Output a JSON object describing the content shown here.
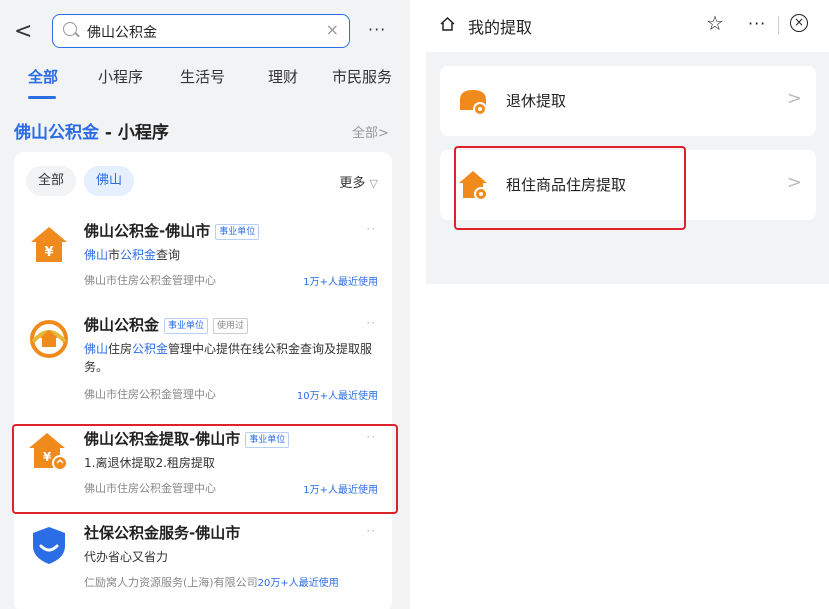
{
  "left": {
    "search": {
      "back": "<",
      "query": "佛山公积金",
      "clear": "×",
      "more": "···"
    },
    "tabs": [
      "全部",
      "小程序",
      "生活号",
      "理财",
      "市民服务"
    ],
    "section": {
      "title_hl": "佛山公积金",
      "title_rest": " - 小程序",
      "all": "全部>"
    },
    "filters": {
      "all": "全部",
      "foshan": "佛山",
      "more": "更多",
      "more_icon": "▽"
    },
    "items": [
      {
        "title": "佛山公积金-佛山市",
        "badge": "事业单位",
        "desc_a": "佛山",
        "desc_b": "市",
        "desc_c": "公积金",
        "desc_d": "查询",
        "org": "佛山市住房公积金管理中心",
        "users": "1万+人最近使用",
        "more": "··"
      },
      {
        "title": "佛山公积金",
        "badge": "事业单位",
        "badge2": "使用过",
        "desc_a": "佛山",
        "desc_b": "住房",
        "desc_c": "公积金",
        "desc_d": "管理中心提供在线公积金查询及提取服务。",
        "org": "佛山市住房公积金管理中心",
        "users": "10万+人最近使用",
        "more": "··"
      },
      {
        "title": "佛山公积金提取-佛山市",
        "badge": "事业单位",
        "desc": "1.离退休提取2.租房提取",
        "org": "佛山市住房公积金管理中心",
        "users": "1万+人最近使用",
        "more": "··"
      },
      {
        "title": "社保公积金服务-佛山市",
        "desc": "代办省心又省力",
        "org": "仁励窝人力资源服务(上海)有限公司",
        "users": "20万+人最近使用",
        "more": "··"
      }
    ]
  },
  "right": {
    "title": "我的提取",
    "star": "☆",
    "dots": "···",
    "close": "×",
    "items": [
      {
        "label": "退休提取",
        "chev": ">"
      },
      {
        "label": "租住商品住房提取",
        "chev": ">"
      }
    ]
  },
  "colors": {
    "accent": "#2b6de5",
    "orange": "#f08a1c",
    "highlight_box": "#e0202a"
  }
}
